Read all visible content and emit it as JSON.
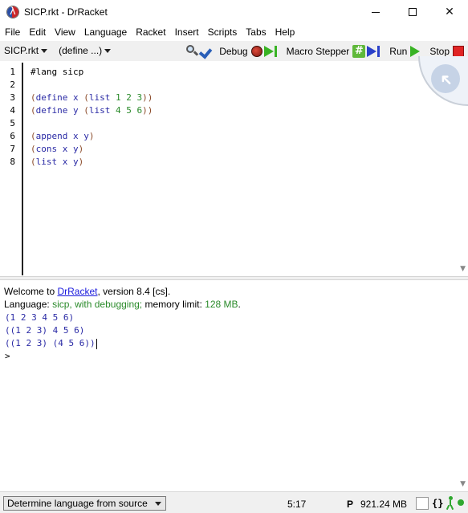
{
  "window": {
    "title": "SICP.rkt - DrRacket",
    "controls": {
      "minimize": "minimize",
      "maximize": "maximize",
      "close": "✕"
    }
  },
  "menu": [
    "File",
    "Edit",
    "View",
    "Language",
    "Racket",
    "Insert",
    "Scripts",
    "Tabs",
    "Help"
  ],
  "toolbar": {
    "file_menu": "SICP.rkt",
    "defines_menu": "(define ...)",
    "check_syntax_icon": "magnifier-check-icon",
    "debug_label": "Debug",
    "macro_stepper_label": "Macro Stepper",
    "run_label": "Run",
    "stop_label": "Stop"
  },
  "editor": {
    "line_numbers": [
      "1",
      "2",
      "3",
      "4",
      "5",
      "6",
      "7",
      "8"
    ],
    "lines": [
      "#lang sicp",
      "",
      "(define x (list 1 2 3))",
      "(define y (list 4 5 6))",
      "",
      "(append x y)",
      "(cons x y)",
      "(list x y)"
    ]
  },
  "interactions": {
    "welcome_prefix": "Welcome to ",
    "welcome_link": "DrRacket",
    "welcome_suffix": ", version 8.4 [cs].",
    "language_prefix": "Language: ",
    "language_value": "sicp, with debugging;",
    "memory_prefix": " memory limit: ",
    "memory_value": "128 MB",
    "memory_suffix": ".",
    "outputs": [
      "(1 2 3 4 5 6)",
      "((1 2 3) 4 5 6)",
      "((1 2 3) (4 5 6))"
    ],
    "prompt": ">"
  },
  "status": {
    "language_select": "Determine language from source",
    "position": "5:17",
    "mem_prefix": "P",
    "memory": "921.24 MB",
    "braces": "{}"
  },
  "colors": {
    "paren": "#8b4b2a",
    "identifier": "#2a2aa5",
    "number": "#2a8a2a",
    "run_green": "#39b324",
    "stop_red": "#e02424"
  }
}
